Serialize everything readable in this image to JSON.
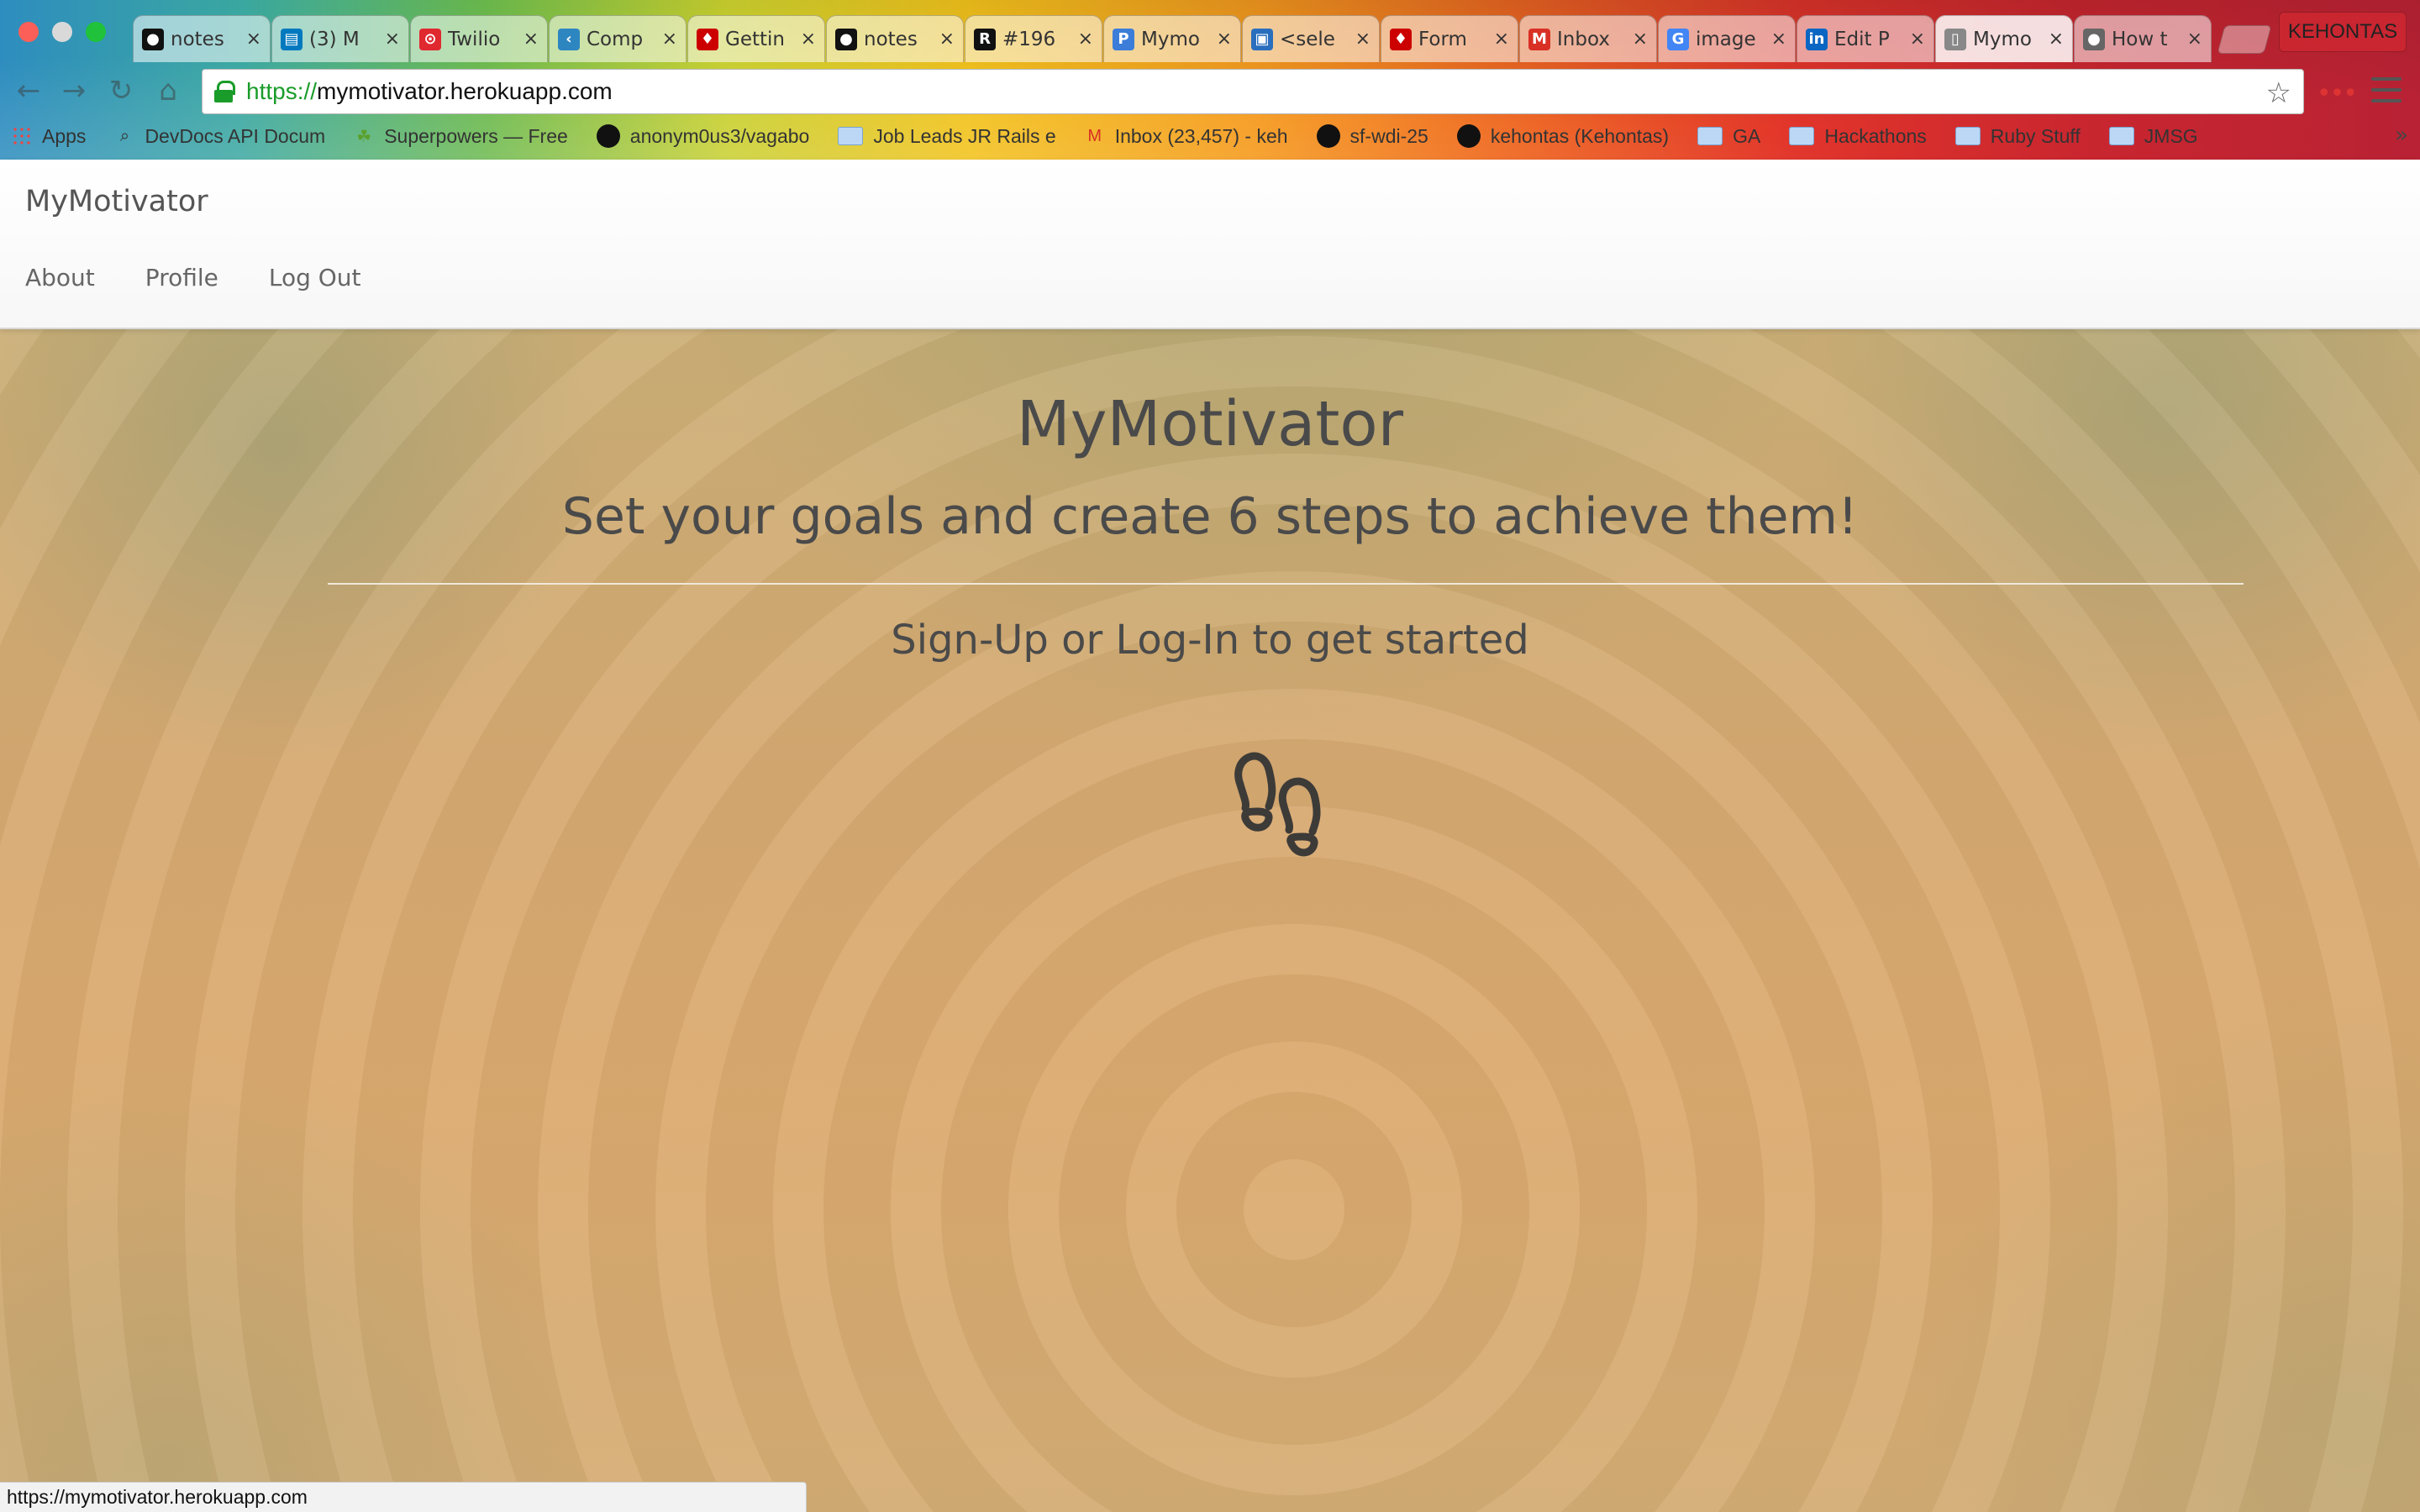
{
  "browser": {
    "profile_name": "KEHONTAS",
    "tabs": [
      {
        "title": "notes",
        "icon": "github-icon",
        "color": "#111111"
      },
      {
        "title": "(3) M",
        "icon": "trello-icon",
        "color": "#0079bf"
      },
      {
        "title": "Twilio",
        "icon": "twilio-icon",
        "color": "#e0282f"
      },
      {
        "title": "Comp",
        "icon": "code-icon",
        "color": "#2e86c1"
      },
      {
        "title": "Gettin",
        "icon": "rails-icon",
        "color": "#cc0000"
      },
      {
        "title": "notes",
        "icon": "github-icon",
        "color": "#111111"
      },
      {
        "title": "#196",
        "icon": "r-icon",
        "color": "#111111"
      },
      {
        "title": "Mymo",
        "icon": "p-icon",
        "color": "#3b7dd8"
      },
      {
        "title": "<sele",
        "icon": "devdocs-icon",
        "color": "#2a6fbd"
      },
      {
        "title": "Form",
        "icon": "rails-icon",
        "color": "#cc0000"
      },
      {
        "title": "Inbox",
        "icon": "gmail-icon",
        "color": "#d93025"
      },
      {
        "title": "image",
        "icon": "google-icon",
        "color": "#4285f4"
      },
      {
        "title": "Edit P",
        "icon": "linkedin-icon",
        "color": "#0a66c2"
      },
      {
        "title": "Mymo",
        "icon": "page-icon",
        "color": "#888888",
        "active": true
      },
      {
        "title": "How t",
        "icon": "apple-icon",
        "color": "#666666"
      }
    ],
    "address": {
      "scheme": "https://",
      "host": "mymotivator.herokuapp.com"
    },
    "bookmarks": [
      {
        "label": "Apps",
        "kind": "apps"
      },
      {
        "label": "DevDocs API Docum",
        "kind": "search"
      },
      {
        "label": "Superpowers — Free",
        "kind": "leaf"
      },
      {
        "label": "anonym0us3/vagabo",
        "kind": "github"
      },
      {
        "label": "Job Leads JR Rails e",
        "kind": "folder"
      },
      {
        "label": "Inbox (23,457) - keh",
        "kind": "gmail"
      },
      {
        "label": "sf-wdi-25",
        "kind": "github"
      },
      {
        "label": "kehontas (Kehontas)",
        "kind": "github"
      },
      {
        "label": "GA",
        "kind": "folder"
      },
      {
        "label": "Hackathons",
        "kind": "folder"
      },
      {
        "label": "Ruby Stuff",
        "kind": "folder"
      },
      {
        "label": "JMSG",
        "kind": "folder"
      }
    ],
    "bookmarks_overflow": "»",
    "status_url": "https://mymotivator.herokuapp.com"
  },
  "site": {
    "brand": "MyMotivator",
    "nav": [
      "About",
      "Profile",
      "Log Out"
    ]
  },
  "hero": {
    "title": "MyMotivator",
    "subtitle": "Set your goals and create 6 steps to achieve them!",
    "cta": "Sign-Up or Log-In to get started",
    "logo_icon": "footprints-icon"
  }
}
